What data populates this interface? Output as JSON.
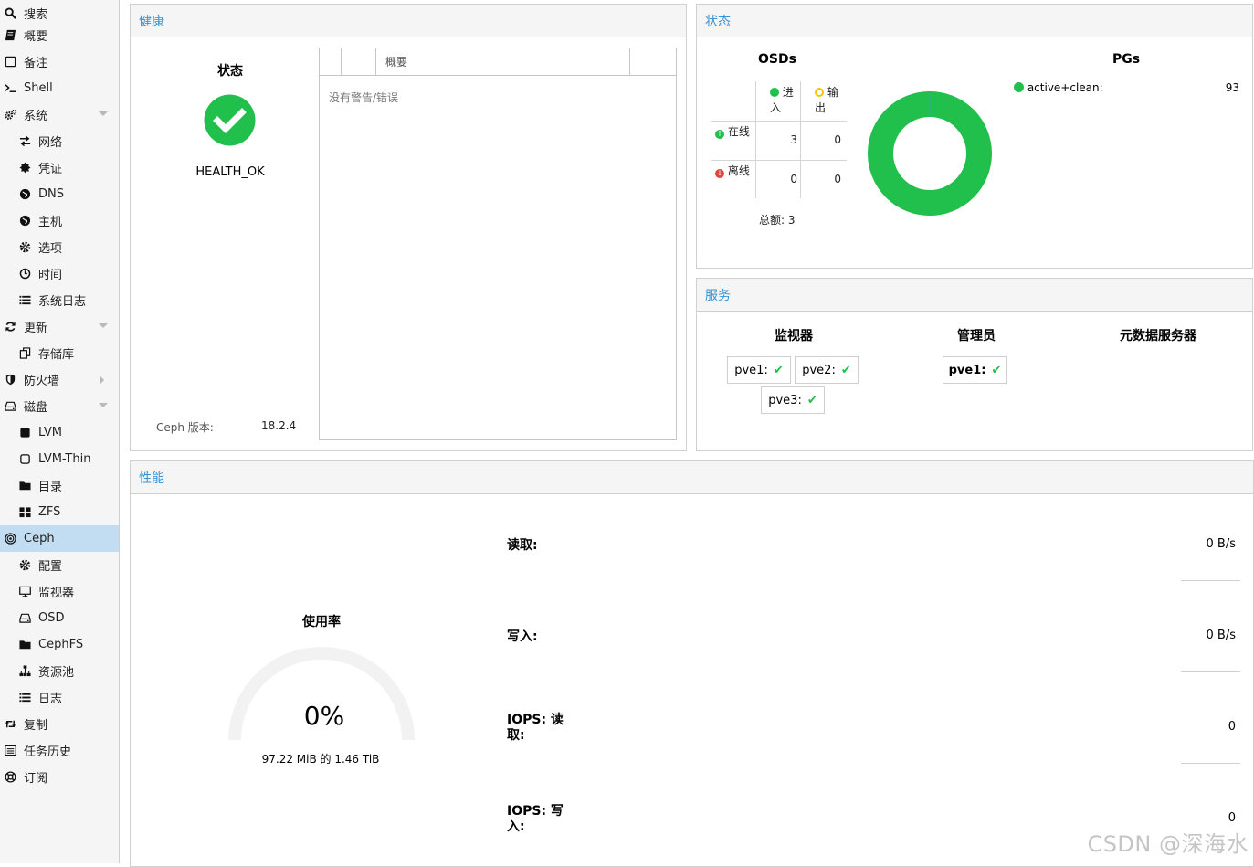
{
  "sidebar": {
    "items": [
      {
        "label": "搜索",
        "icon": "search-icon"
      },
      {
        "label": "概要",
        "icon": "book-icon"
      },
      {
        "label": "备注",
        "icon": "note-icon"
      },
      {
        "label": "Shell",
        "icon": "terminal-icon"
      },
      {
        "label": "系统",
        "icon": "cogs-icon"
      },
      {
        "label": "网络",
        "icon": "exchange-icon"
      },
      {
        "label": "凭证",
        "icon": "certificate-icon"
      },
      {
        "label": "DNS",
        "icon": "globe-icon"
      },
      {
        "label": "主机",
        "icon": "globe-icon"
      },
      {
        "label": "选项",
        "icon": "gear-icon"
      },
      {
        "label": "时间",
        "icon": "clock-icon"
      },
      {
        "label": "系统日志",
        "icon": "list-icon"
      },
      {
        "label": "更新",
        "icon": "refresh-icon"
      },
      {
        "label": "存储库",
        "icon": "files-icon"
      },
      {
        "label": "防火墙",
        "icon": "shield-icon"
      },
      {
        "label": "磁盘",
        "icon": "hdd-icon"
      },
      {
        "label": "LVM",
        "icon": "square-icon"
      },
      {
        "label": "LVM-Thin",
        "icon": "square-outline-icon"
      },
      {
        "label": "目录",
        "icon": "folder-icon"
      },
      {
        "label": "ZFS",
        "icon": "grid-icon"
      },
      {
        "label": "Ceph",
        "icon": "ceph-icon"
      },
      {
        "label": "配置",
        "icon": "gear-icon"
      },
      {
        "label": "监视器",
        "icon": "monitor-icon"
      },
      {
        "label": "OSD",
        "icon": "hdd-icon"
      },
      {
        "label": "CephFS",
        "icon": "folder-icon"
      },
      {
        "label": "资源池",
        "icon": "sitemap-icon"
      },
      {
        "label": "日志",
        "icon": "list-icon"
      },
      {
        "label": "复制",
        "icon": "retweet-icon"
      },
      {
        "label": "任务历史",
        "icon": "tasks-icon"
      },
      {
        "label": "订阅",
        "icon": "support-icon"
      }
    ]
  },
  "health": {
    "title": "健康",
    "status_heading": "状态",
    "status_text": "HEALTH_OK",
    "ceph_version_label": "Ceph 版本:",
    "ceph_version": "18.2.4",
    "summary_header": "概要",
    "no_warnings": "没有警告/错误"
  },
  "status": {
    "title": "状态",
    "osds_heading": "OSDs",
    "pgs_heading": "PGs",
    "in_label": "进入",
    "out_label": "输出",
    "up_label": "在线",
    "down_label": "离线",
    "up_in": "3",
    "up_out": "0",
    "down_in": "0",
    "down_out": "0",
    "total": "总额: 3",
    "pg_state": "active+clean:",
    "pg_count": "93",
    "pg_color": "#21bf4b"
  },
  "services": {
    "title": "服务",
    "monitors_heading": "监视器",
    "managers_heading": "管理员",
    "mds_heading": "元数据服务器",
    "monitors": [
      "pve1:",
      "pve2:",
      "pve3:"
    ],
    "managers": [
      "pve1:"
    ]
  },
  "performance": {
    "title": "性能",
    "usage_heading": "使用率",
    "usage_percent": "0%",
    "usage_fraction": 0.0,
    "usage_detail": "97.22 MiB 的 1.46 TiB",
    "read_label": "读取:",
    "read_value": "0 B/s",
    "write_label": "写入:",
    "write_value": "0 B/s",
    "iops_read_label": "IOPS: 读取:",
    "iops_read_value": "0",
    "iops_write_label": "IOPS: 写入:",
    "iops_write_value": "0"
  },
  "watermark": "CSDN @深海水",
  "colors": {
    "accent": "#3892d4",
    "ok": "#21bf4b",
    "warn": "#f5c400",
    "error": "#e0473c"
  }
}
